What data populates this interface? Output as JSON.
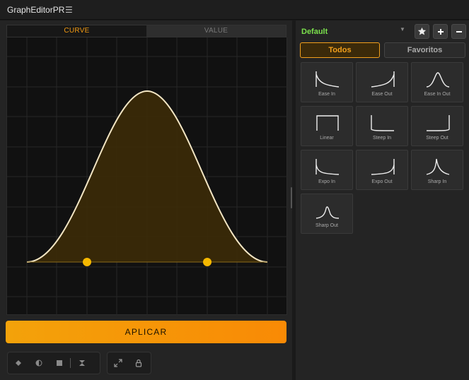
{
  "window": {
    "title": "GraphEditorPR",
    "menu_icon": "hamburger-icon"
  },
  "graph_tabs": {
    "curve": "CURVE",
    "value": "VALUE",
    "active": "CURVE"
  },
  "apply_label": "APLICAR",
  "colors": {
    "accent": "#f29a12",
    "preset_name": "#7be04c",
    "curve_stroke": "#f3e6c4",
    "handle": "#f5b800"
  },
  "toolbar": {
    "group1": [
      "diamond-keyframe-icon",
      "half-circle-icon",
      "square-icon",
      "hourglass-icon"
    ],
    "group2": [
      "expand-icon",
      "lock-icon"
    ]
  },
  "presets": {
    "selected": "Default",
    "filters": {
      "all": "Todos",
      "favorites": "Favoritos",
      "active": "Todos"
    },
    "items": [
      {
        "label": "Ease In",
        "icon": "ease-in-curve-icon"
      },
      {
        "label": "Ease Out",
        "icon": "ease-out-curve-icon"
      },
      {
        "label": "Ease In Out",
        "icon": "ease-in-out-curve-icon"
      },
      {
        "label": "Linear",
        "icon": "linear-curve-icon"
      },
      {
        "label": "Steep In",
        "icon": "steep-in-curve-icon"
      },
      {
        "label": "Steep Out",
        "icon": "steep-out-curve-icon"
      },
      {
        "label": "Expo In",
        "icon": "expo-in-curve-icon"
      },
      {
        "label": "Expo Out",
        "icon": "expo-out-curve-icon"
      },
      {
        "label": "Sharp In",
        "icon": "sharp-in-curve-icon"
      },
      {
        "label": "Sharp Out",
        "icon": "sharp-out-curve-icon"
      }
    ]
  }
}
